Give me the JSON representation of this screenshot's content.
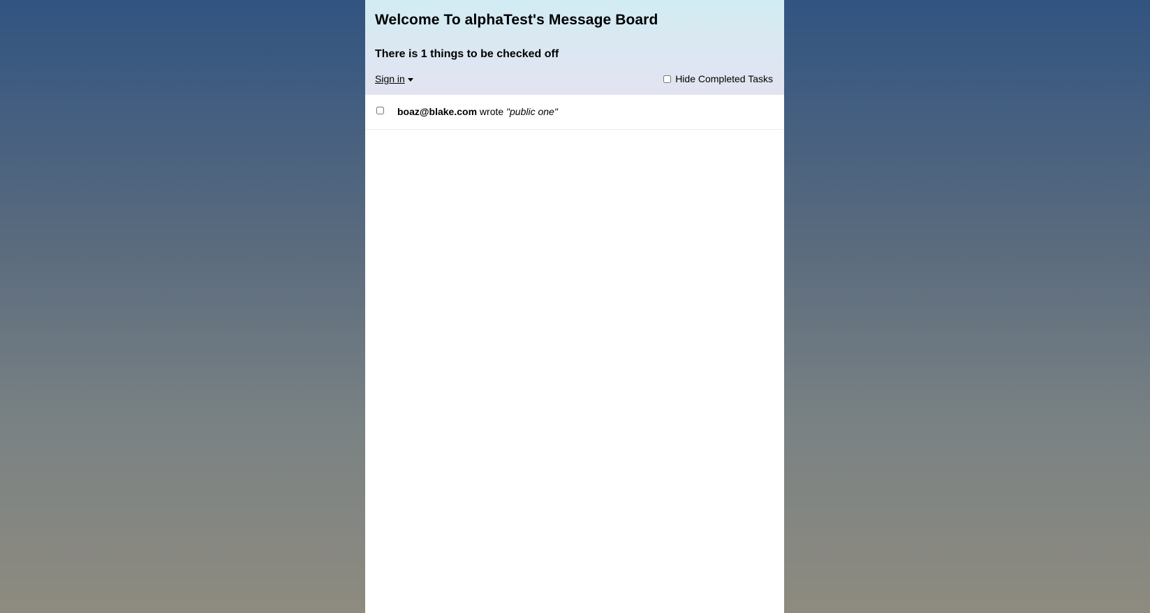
{
  "header": {
    "title": "Welcome To alphaTest's Message Board",
    "subtitle": "There is 1 things to be checked off",
    "sign_in_label": "Sign in",
    "hide_completed_label": "Hide Completed Tasks"
  },
  "tasks": [
    {
      "author": "boaz@blake.com",
      "verb": "wrote",
      "message": "\"public one\"",
      "checked": false
    }
  ],
  "colors": {
    "header_gradient_top": "#d2ecf3",
    "header_gradient_bottom": "#e3e3f1",
    "background_top": "#315481",
    "background_bottom": "#8e8b80"
  },
  "icons": {
    "sign_in_dropdown": "caret-down-icon"
  }
}
